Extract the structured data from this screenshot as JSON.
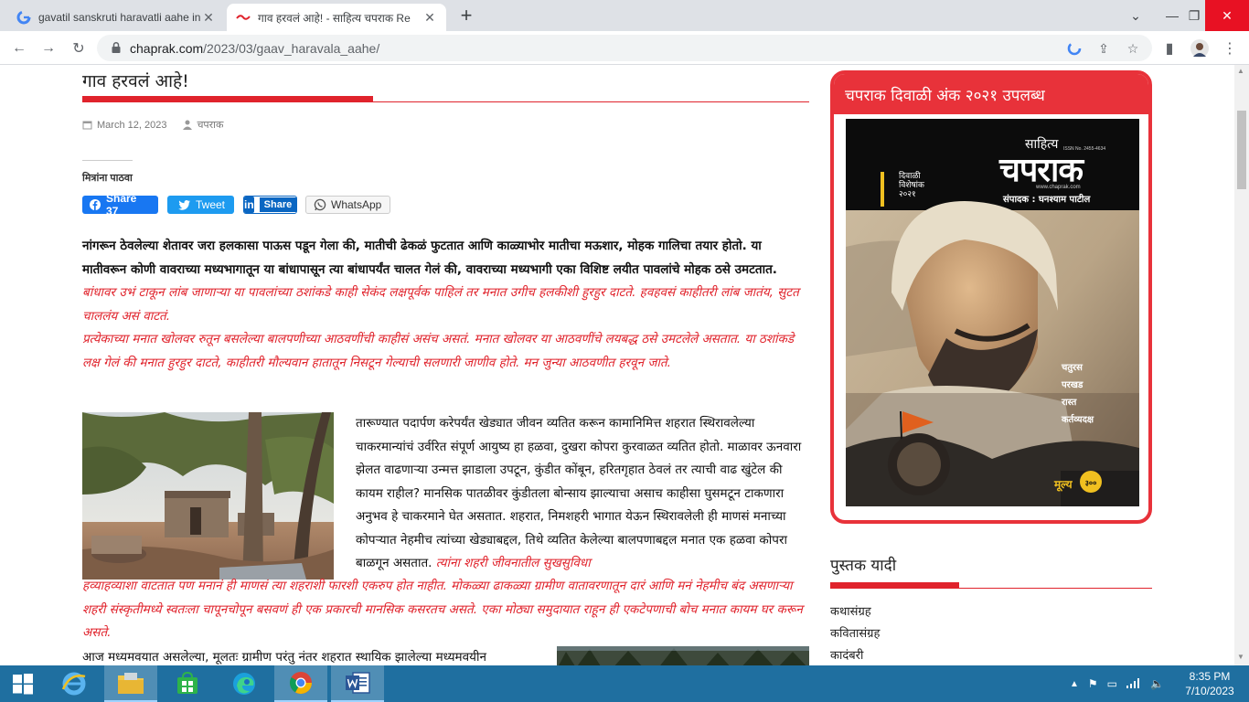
{
  "browser": {
    "tabs": [
      {
        "title": "gavatil sanskruti haravatli aahe in",
        "active": false
      },
      {
        "title": "गाव हरवलं आहे! - साहित्य चपराक Re",
        "active": true
      }
    ],
    "address": {
      "host": "chaprak.com",
      "path": "/2023/03/gaav_haravala_aahe/"
    }
  },
  "article": {
    "title": "गाव हरवलं आहे!",
    "date": "March 12, 2023",
    "author": "चपराक",
    "share_heading": "मित्रांना पाठवा",
    "share": {
      "facebook": "Share 37",
      "twitter": "Tweet",
      "linkedin": "Share",
      "whatsapp": "WhatsApp"
    },
    "p1_bold": "नांगरून ठेवलेल्या शेतावर जरा हलकासा पाऊस पडून गेला की, मातीची ढेकळं फुटतात आणि काळ्याभोर मातीचा मऊशार, मोहक गालिचा तयार होतो. या मातीवरून कोणी वावराच्या मध्यभागातून या बांधापासून त्या बांधापर्यंत चालत गेलं की, वावराच्या मध्यभागी एका विशिष्ट लयीत पावलांचे मोहक ठसे उमटतात.",
    "p1_red": "बांधावर उभं टाकून लांब जाणाऱ्या या पावलांच्या ठशांकडे काही सेकंद लक्षपूर्वक पाहिलं तर मनात उगीच हलकीशी हुरहुर दाटते. हवहवसं काहीतरी लांब जातंय, सुटत चाललंय असं वाटतं.",
    "p2": "प्रत्येकाच्या मनात खोलवर रुतून बसलेल्या बालपणीच्या आठवणींची काहीसं असंच असतं. मनात खोलवर या आठवणींचे लयबद्ध ठसे उमटलेले असतात. या ठशांकडे लक्ष गेलं की मनात हुरहुर दाटते, काहीतरी मौल्यवान हातातून निसटून गेल्याची सलणारी जाणीव होते. मन जुन्या आठवणीत हरवून जाते.",
    "p3": "तारूण्यात पदार्पण करेपर्यंत खेड्यात जीवन व्यतित करून कामानिमित्त शहरात स्थिरावलेल्या चाकरमान्यांचं उर्वरित संपूर्ण आयुष्य हा हळवा, दुखरा कोपरा कुरवाळत व्यतित होतो. माळावर ऊनवारा झेलत वाढणाऱ्या उन्मत्त झाडाला उपटून, कुंडीत कोंबून, हरितगृहात ठेवलं तर त्याची वाढ खुंटेल की कायम राहील? मानसिक पातळीवर कुंडीतला बोन्साय झाल्याचा असाच काहीसा घुसमटून टाकणारा अनुभव हे चाकरमाने घेत असतात. शहरात, निमशहरी भागात येऊन स्थिरावलेली ही माणसं मनाच्या कोपऱ्यात नेहमीच त्यांच्या खेड्याबद्दल, तिथे व्यतित केलेल्या बालपणाबद्दल मनात एक हळवा कोपरा बाळगून असतात.",
    "p3_red_a": "त्यांना शहरी जीवनातील सुखसुविधा",
    "p3_red_b": "हव्याहव्याशा वाटतात पण मनानं ही माणसं त्या शहराशी फारशी एकरुप होत नाहीत. मोकळ्या ढाकळ्या ग्रामीण वातावरणातून दारं आणि मनं नेहमीच बंद असणाऱ्या शहरी संस्कृतीमध्ये स्वतःला चापूनचोपून बसवणं ही एक प्रकारची मानसिक कसरतच असते. एका मोठ्या समुदायात राहून ही एकटेपणाची बोच मनात कायम घर करून असते.",
    "p4": "आज मध्यमवयात असलेल्या, मूलतः ग्रामीण परंतु नंतर शहरात स्थायिक झालेल्या मध्यमवयीन"
  },
  "sidebar": {
    "promo_title": "चपराक दिवाळी अंक २०२१ उपलब्ध",
    "cover": {
      "small_top": "साहित्य",
      "brand": "चपराक",
      "issn": "ISSN No. 2455-4634",
      "site": "www.chaprak.com",
      "editor": "संपादक : घनश्याम पाटील",
      "badge_line1": "दिवाळी",
      "badge_line2": "विशेषांक",
      "badge_line3": "२०२१",
      "list": [
        "चतुरस",
        "परखड",
        "रास्त",
        "कर्तव्यदक्ष"
      ],
      "price_label": "मूल्य",
      "price": "३००"
    },
    "list_title": "पुस्तक यादी",
    "list_items": [
      "कथासंग्रह",
      "कवितासंग्रह",
      "कादंबरी"
    ]
  },
  "taskbar": {
    "time": "8:35 PM",
    "date": "7/10/2023"
  },
  "colors": {
    "accent": "#e0232c",
    "facebook": "#1877f2",
    "twitter": "#1d9bf0",
    "linkedin": "#0a66c2",
    "taskbar": "#1f6fa0"
  }
}
